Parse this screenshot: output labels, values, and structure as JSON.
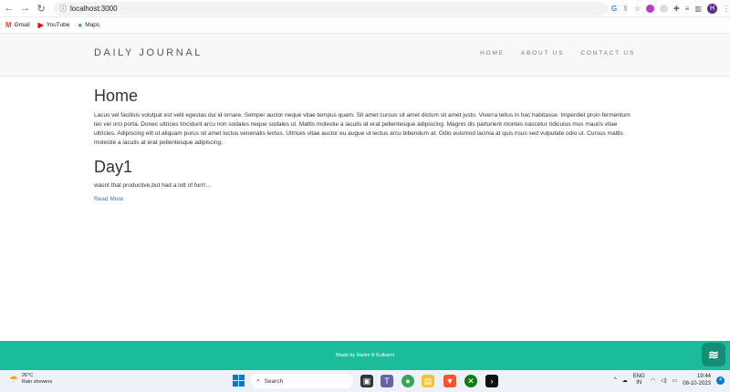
{
  "browser": {
    "url": "localhost:3000",
    "bookmarks": [
      {
        "label": "Gmail",
        "icon": "gmail-icon"
      },
      {
        "label": "YouTube",
        "icon": "youtube-icon"
      },
      {
        "label": "Maps",
        "icon": "maps-icon"
      }
    ],
    "profile_initial": "H"
  },
  "site": {
    "brand": "DAILY JOURNAL",
    "nav": [
      "HOME",
      "ABOUT US",
      "CONTACT US"
    ],
    "home_title": "Home",
    "home_text": "Lacus vel facilisis volutpat est velit egestas dui id ornare. Semper auctor neque vitae tempus quam. Sit amet cursus sit amet dictum sit amet justo. Viverra tellus in hac habitasse. Imperdiet proin fermentum leo vel orci porta. Donec ultrices tincidunt arcu non sodales neque sodales ut. Mattis molestie a iaculis at erat pellentesque adipiscing. Magnis dis parturient montes nascetur ridiculus mus mauris vitae ultricies. Adipiscing elit ut aliquam purus sit amet luctus venenatis lectus. Ultrices vitae auctor eu augue ut lectus arcu bibendum at. Odio euismod lacinia at quis risus sed vulputate odio ut. Cursus mattis molestie a iaculis at erat pellentesque adipiscing.",
    "post_title": "Day1",
    "post_text": "wasnt that productive,but had a lott of fun!!...",
    "read_more": "Read More",
    "footer": "Made by Harini N Kulkarni"
  },
  "taskbar": {
    "temperature": "26°C",
    "weather": "Rain showers",
    "search_placeholder": "Search",
    "lang_1": "ENG",
    "lang_2": "IN",
    "time": "19:44",
    "date": "08-10-2023",
    "notification_count": "4"
  },
  "colors": {
    "footer_bg": "#1abc9c",
    "link": "#337ab7",
    "header_bg": "#f8f8f8"
  }
}
